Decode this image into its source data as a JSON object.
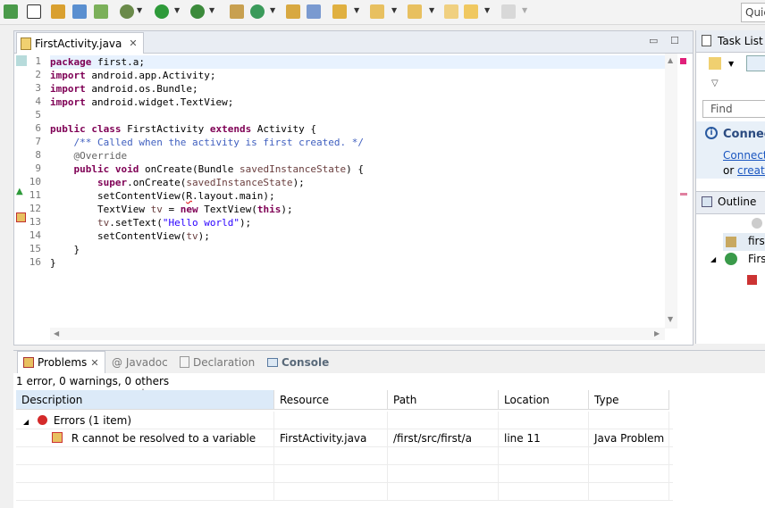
{
  "toolbar": {
    "quick_access": "Quic",
    "icons": [
      "save-icon",
      "save-all-icon",
      "new-package-icon",
      "new-java-icon",
      "new-class-icon",
      "debug-icon",
      "run-icon",
      "run-config-icon",
      "new-wizard-icon",
      "refresh-icon",
      "open-type-icon",
      "open-resource-icon",
      "search-icon",
      "next-annotation-icon",
      "prev-annotation-icon",
      "back-icon",
      "forward-icon"
    ]
  },
  "editor": {
    "tab_label": "FirstActivity.java",
    "line_numbers": [
      "1",
      "2",
      "3",
      "4",
      "5",
      "6",
      "7",
      "8",
      "9",
      "10",
      "11",
      "12",
      "13",
      "14",
      "15",
      "16"
    ]
  },
  "right_panel": {
    "task_list_title": "Task List",
    "find_placeholder": "Find",
    "connect_title": "Connec",
    "connect_link": "Connect",
    "or_text": "or ",
    "create_link": "create",
    "outline_title": "Outline",
    "outline_items": [
      "first",
      "Firs"
    ]
  },
  "bottom": {
    "tabs": [
      "Problems",
      "@ Javadoc",
      "Declaration",
      "Console"
    ],
    "summary": "1 error, 0 warnings, 0 others",
    "columns": [
      "Description",
      "Resource",
      "Path",
      "Location",
      "Type"
    ],
    "group_label": "Errors (1 item)",
    "problem": {
      "description": "R cannot be resolved to a variable",
      "resource": "FirstActivity.java",
      "path": "/first/src/first/a",
      "location": "line 11",
      "type": "Java Problem"
    }
  }
}
